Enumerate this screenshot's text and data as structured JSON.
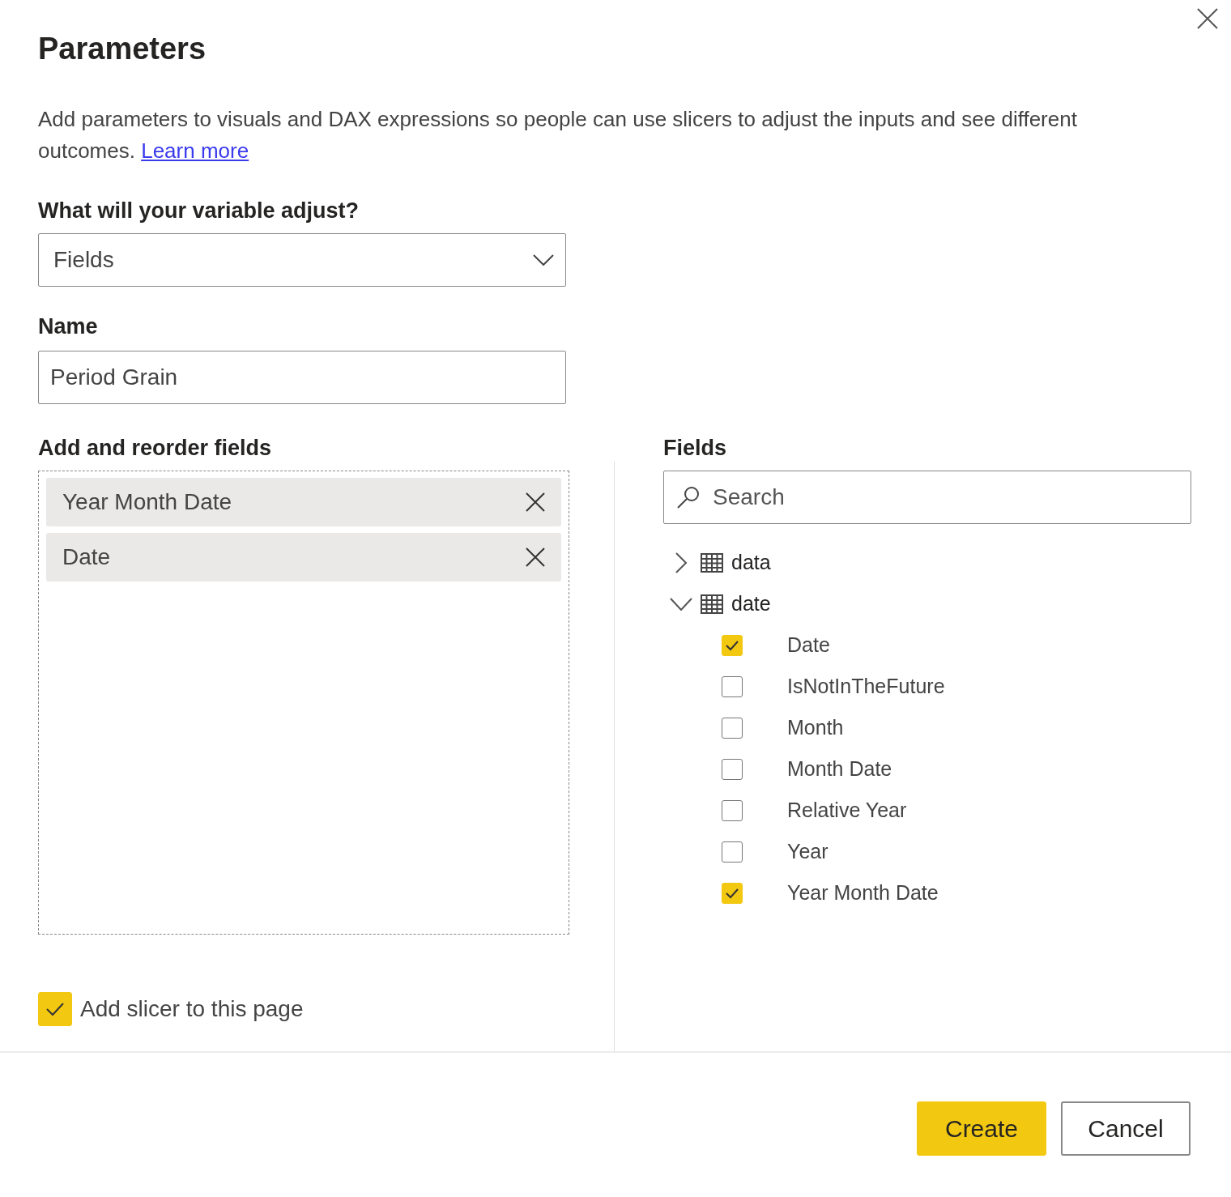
{
  "dialog": {
    "title": "Parameters",
    "description": "Add parameters to visuals and DAX expressions so people can use slicers to adjust the inputs and see different outcomes.",
    "learn_more_link": "Learn more"
  },
  "variable": {
    "label": "What will your variable adjust?",
    "value": "Fields"
  },
  "name": {
    "label": "Name",
    "value": "Period Grain"
  },
  "selected_fields": {
    "label": "Add and reorder fields",
    "items": [
      "Year Month Date",
      "Date"
    ]
  },
  "fields_pane": {
    "label": "Fields",
    "search": {
      "placeholder": "Search"
    },
    "tables": [
      {
        "name": "data",
        "expanded": false
      },
      {
        "name": "date",
        "expanded": true,
        "children": [
          {
            "name": "Date",
            "checked": true
          },
          {
            "name": "IsNotInTheFuture",
            "checked": false
          },
          {
            "name": "Month",
            "checked": false
          },
          {
            "name": "Month Date",
            "checked": false
          },
          {
            "name": "Relative Year",
            "checked": false
          },
          {
            "name": "Year",
            "checked": false
          },
          {
            "name": "Year Month Date",
            "checked": true
          }
        ]
      }
    ]
  },
  "add_slicer": {
    "label": "Add slicer to this page",
    "checked": true
  },
  "buttons": [
    {
      "label": "Create",
      "kind": "primary"
    },
    {
      "label": "Cancel",
      "kind": "secondary"
    }
  ]
}
